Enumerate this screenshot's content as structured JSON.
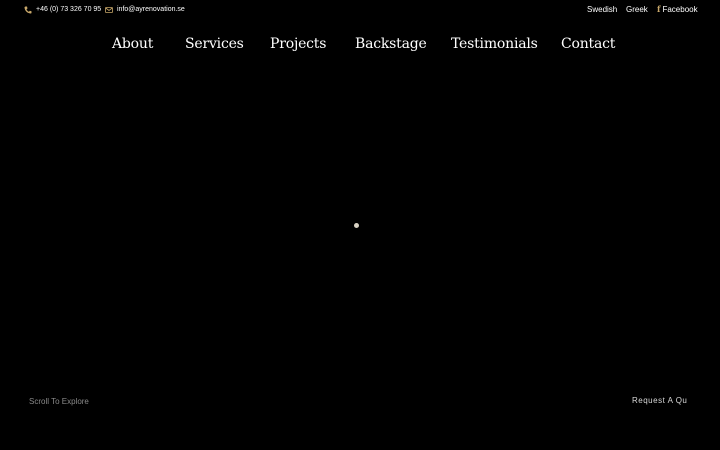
{
  "topbar": {
    "phone": "+46 (0) 73 326 70 95",
    "email": "info@ayrenovation.se",
    "languages": [
      "Swedish",
      "Greek"
    ],
    "facebook_label": "Facebook",
    "accent_color": "#c9a86a"
  },
  "nav": {
    "items": [
      "About",
      "Services",
      "Projects",
      "Backstage",
      "Testimonials",
      "Contact"
    ]
  },
  "hero": {
    "scroll_label": "Scroll To Explore",
    "cta_label": "Request A Qu"
  },
  "colors": {
    "background": "#000000",
    "text": "#ffffff",
    "muted": "#8a8a8a"
  }
}
